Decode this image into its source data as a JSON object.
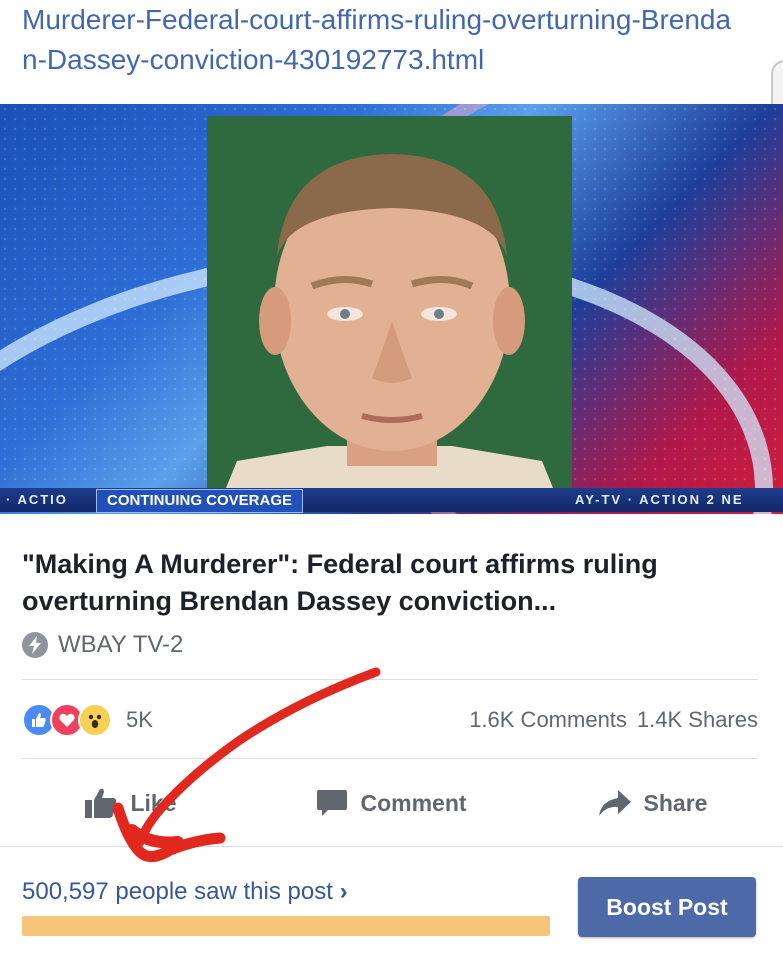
{
  "link": {
    "url_text": "Murderer-Federal-court-affirms-ruling-overturning-Brendan-Dassey-conviction-430192773.html"
  },
  "hero": {
    "ticker_left": "· ACTIO",
    "ticker_right": "AY-TV · ACTION 2 NE",
    "coverage_label": "CONTINUING COVERAGE"
  },
  "post": {
    "headline": "\"Making A Murderer\": Federal court affirms ruling overturning Brendan Dassey conviction...",
    "source": "WBAY TV-2"
  },
  "engagement": {
    "reactions_count": "5K",
    "comments": "1.6K Comments",
    "shares": "1.4K Shares"
  },
  "actions": {
    "like": "Like",
    "comment": "Comment",
    "share": "Share"
  },
  "reach": {
    "text": "500,597 people saw this post",
    "chevron": "›",
    "progress_fraction": 0.7
  },
  "boost": {
    "label": "Boost Post"
  },
  "colors": {
    "link": "#4267b2",
    "boost_button": "#4d69a8",
    "reach_bar": "#f7c57a",
    "annotation": "#e0281e"
  }
}
